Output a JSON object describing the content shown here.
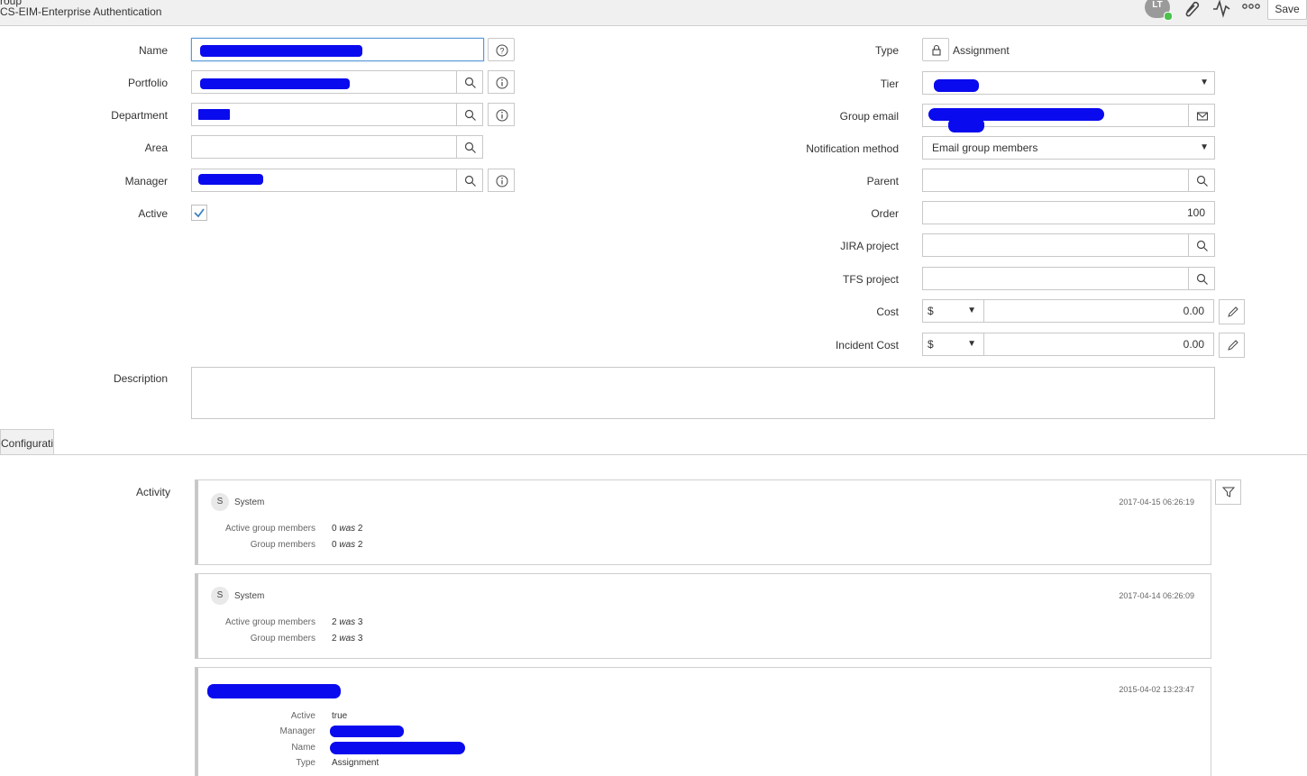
{
  "header": {
    "label": "roup",
    "title": "CS-EIM-Enterprise Authentication",
    "avatar_initials": "LT",
    "save_label": "Save"
  },
  "form": {
    "name_label": "Name",
    "name_value": "",
    "portfolio_label": "Portfolio",
    "portfolio_value": "",
    "department_label": "Department",
    "department_value": "",
    "area_label": "Area",
    "area_value": "",
    "manager_label": "Manager",
    "manager_value": "",
    "active_label": "Active",
    "active_checked": true,
    "type_label": "Type",
    "type_value": "Assignment",
    "tier_label": "Tier",
    "tier_value": "",
    "group_email_label": "Group email",
    "group_email_value": "",
    "notification_label": "Notification method",
    "notification_value": "Email group members",
    "parent_label": "Parent",
    "parent_value": "",
    "order_label": "Order",
    "order_value": "100",
    "jira_label": "JIRA project",
    "jira_value": "",
    "tfs_label": "TFS project",
    "tfs_value": "",
    "cost_label": "Cost",
    "cost_currency": "$",
    "cost_value": "0.00",
    "incident_cost_label": "Incident Cost",
    "incident_cost_currency": "$",
    "incident_cost_value": "0.00",
    "description_label": "Description"
  },
  "tabs": {
    "configuration": "Configuration"
  },
  "activity": {
    "label": "Activity",
    "entries": [
      {
        "user": "System",
        "badge": "S",
        "timestamp": "2017-04-15 06:26:19",
        "fields": [
          {
            "label": "Active group members",
            "value": "0",
            "was": "was",
            "old": "2"
          },
          {
            "label": "Group members",
            "value": "0",
            "was": "was",
            "old": "2"
          }
        ]
      },
      {
        "user": "System",
        "badge": "S",
        "timestamp": "2017-04-14 06:26:09",
        "fields": [
          {
            "label": "Active group members",
            "value": "2",
            "was": "was",
            "old": "3"
          },
          {
            "label": "Group members",
            "value": "2",
            "was": "was",
            "old": "3"
          }
        ]
      },
      {
        "user": "",
        "timestamp": "2015-04-02 13:23:47",
        "fields": [
          {
            "label": "Active",
            "value": "true"
          },
          {
            "label": "Manager",
            "value": ""
          },
          {
            "label": "Name",
            "value": ""
          },
          {
            "label": "Type",
            "value": "Assignment"
          }
        ]
      }
    ]
  },
  "colors": {
    "redaction": "#0a0aee",
    "focus_border": "#5b9bd5",
    "check": "#3b82c4"
  }
}
